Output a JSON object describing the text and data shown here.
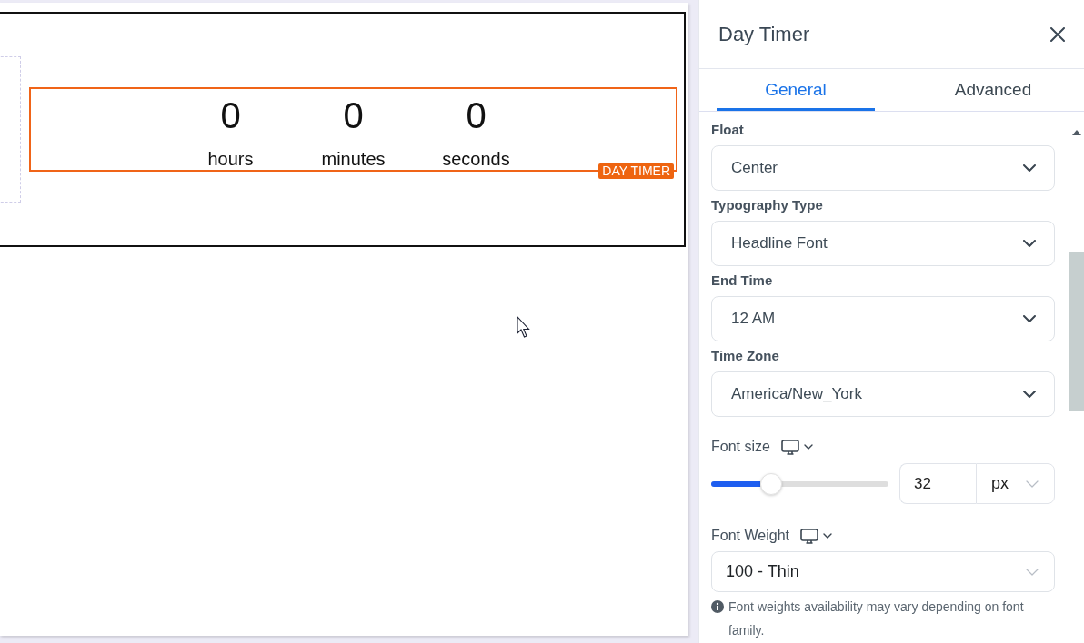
{
  "canvas": {
    "timer": {
      "units": [
        {
          "value": "0",
          "label": "hours"
        },
        {
          "value": "0",
          "label": "minutes"
        },
        {
          "value": "0",
          "label": "seconds"
        }
      ],
      "badge": "DAY TIMER"
    }
  },
  "panel": {
    "title": "Day Timer",
    "tabs": [
      {
        "label": "General",
        "selected": true
      },
      {
        "label": "Advanced",
        "selected": false
      }
    ],
    "fields": [
      {
        "kind": "select",
        "label": "Float",
        "responsive": false,
        "value": "Center"
      },
      {
        "kind": "select",
        "label": "Typography Type",
        "responsive": false,
        "value": "Headline Font"
      },
      {
        "kind": "select",
        "label": "End Time",
        "responsive": false,
        "value": "12 AM"
      },
      {
        "kind": "select",
        "label": "Time Zone",
        "responsive": false,
        "value": "America/New_York"
      },
      {
        "kind": "slider",
        "label": "Font size",
        "responsive": true,
        "level": 0.34,
        "value": "32",
        "unit": "px"
      },
      {
        "kind": "compact",
        "label": "Font Weight",
        "responsive": true,
        "value": "100 - Thin",
        "note": "Font weights availability may vary depending on font family."
      }
    ]
  }
}
